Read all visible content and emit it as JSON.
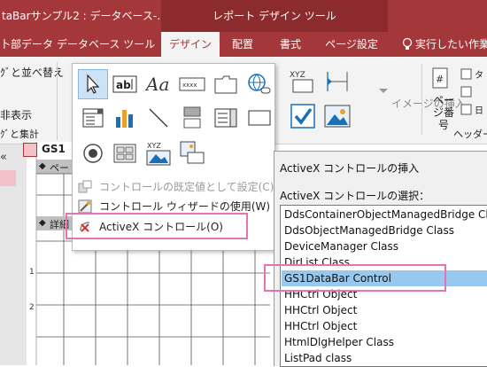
{
  "title_bar": {
    "window_title": "taBarサンプル2 : データベース-…",
    "context_tab_group": "レポート デザイン ツール"
  },
  "ribbon_tabs": [
    {
      "label": "卜部データ"
    },
    {
      "label": "データベース ツール"
    },
    {
      "label": "デザイン"
    },
    {
      "label": "配置"
    },
    {
      "label": "書式"
    },
    {
      "label": "ページ設定"
    }
  ],
  "tell_me": "実行したい作業を",
  "ribbon_left": {
    "group_sort": "ｸﾞと並べ替え",
    "hide_details": "非表示",
    "group_footer": "ｸﾞと集計"
  },
  "ribbon_right": {
    "image_insert": "イメージの挿入",
    "page_number": "ページ番号",
    "header_footer": "ヘッダー/フ"
  },
  "gallery_menu": {
    "set_default": "コントロールの既定値として設定(C)",
    "use_wizard": "コントロール ウィザードの使用(W)",
    "activex": "ActiveX コントロール(O)"
  },
  "report": {
    "tab_title": "GS1",
    "page_header": "ペー",
    "detail": "詳細",
    "ruler_marks": [
      "1",
      "2"
    ]
  },
  "dialog": {
    "title": "ActiveX コントロールの挿入",
    "select_label": "ActiveX コントロールの選択：",
    "items": [
      "DdsContainerObjectManagedBridge Class",
      "DdsObjectManagedBridge Class",
      "DeviceManager Class",
      "DirList Class",
      "GS1DataBar Control",
      "HHCtrl Object",
      "HHCtrl Object",
      "HHCtrl Object",
      "HtmlDlgHelper Class",
      "ListPad class"
    ],
    "selected_index": 4
  },
  "colors": {
    "accent": "#a4373a",
    "selection": "#99c8ee",
    "highlight": "#e873b3"
  }
}
